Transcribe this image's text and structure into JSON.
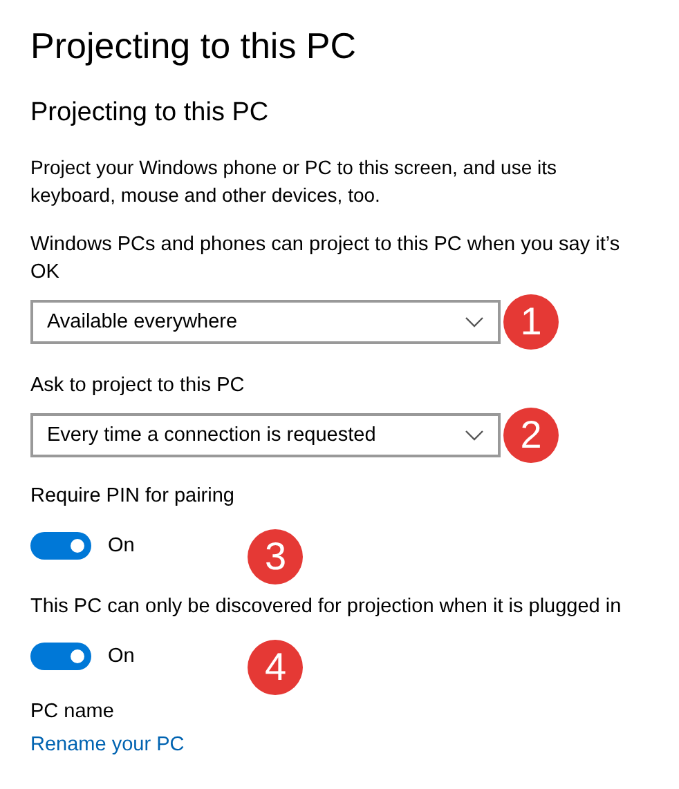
{
  "page_title": "Projecting to this PC",
  "section_title": "Projecting to this PC",
  "description": "Project your Windows phone or PC to this screen, and use its keyboard, mouse and other devices, too.",
  "settings": [
    {
      "kind": "dropdown",
      "label": "Windows PCs and phones can project to this PC when you say it’s OK",
      "value": "Available everywhere",
      "badge": "1"
    },
    {
      "kind": "dropdown",
      "label": "Ask to project to this PC",
      "value": "Every time a connection is requested",
      "badge": "2"
    },
    {
      "kind": "toggle",
      "label": "Require PIN for pairing",
      "on": true,
      "state_text": "On",
      "badge": "3"
    },
    {
      "kind": "toggle",
      "label": "This PC can only be discovered for projection when it is plugged in",
      "on": true,
      "state_text": "On",
      "badge": "4"
    }
  ],
  "pc_name_label": "PC name",
  "rename_link": "Rename your PC"
}
